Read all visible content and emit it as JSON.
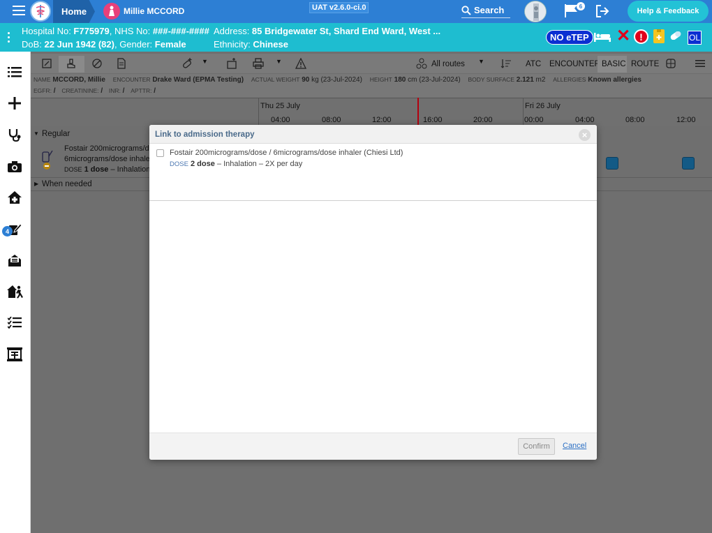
{
  "topbar": {
    "home_label": "Home",
    "patient_name": "Millie MCCORD",
    "env_version": "UAT v2.6.0-ci.0",
    "search_label": "Search",
    "flag_count": "6",
    "help_label": "Help & Feedback"
  },
  "banner": {
    "hospital_label": "Hospital No: ",
    "hospital_no": "F775979",
    "nhs_label": ", NHS No: ",
    "nhs_no": "###-###-####",
    "dob_label": "DoB: ",
    "dob": "22 Jun 1942 (82)",
    "gender_label": ", Gender: ",
    "gender": "Female",
    "address_label": "Address: ",
    "address": "85 Bridgewater St, Shard End Ward, West ...",
    "ethnicity_label": "Ethnicity: ",
    "ethnicity": "Chinese",
    "no_etep": "NO eTEP",
    "ol_badge": "OL",
    "alert_symbol": "!"
  },
  "sidebar": {
    "tasks_badge": "4"
  },
  "toolbar": {
    "routes_label": "All routes",
    "atc": "ATC",
    "encounter": "ENCOUNTER",
    "basic": "BASIC",
    "route": "ROUTE"
  },
  "patient_info": {
    "name_lbl": "NAME",
    "name": "MCCORD, Millie",
    "encounter_lbl": "ENCOUNTER",
    "encounter": "Drake Ward (EPMA Testing)",
    "weight_lbl": "ACTUAL WEIGHT",
    "weight": "90",
    "weight_unit": "kg",
    "weight_date": "(23-Jul-2024)",
    "height_lbl": "HEIGHT",
    "height": "180",
    "height_unit": "cm",
    "height_date": "(23-Jul-2024)",
    "bsa_lbl": "BODY SURFACE",
    "bsa": "2.121",
    "bsa_unit": "m2",
    "allergies_lbl": "ALLERGIES",
    "allergies": "Known allergies",
    "egfr_lbl": "EGFR:",
    "egfr": "/",
    "creat_lbl": "CREATININE:",
    "creat": "/",
    "inr_lbl": "INR:",
    "inr": "/",
    "apttr_lbl": "APTTR:",
    "apttr": "/"
  },
  "timeline": {
    "day1": "Thu 25 July",
    "day2": "Fri 26 July",
    "hours": [
      "04:00",
      "08:00",
      "12:00",
      "16:00",
      "20:00",
      "00:00",
      "04:00",
      "08:00",
      "12:00"
    ]
  },
  "rows": {
    "regular": "Regular",
    "drug_line1": "Fostair 200micrograms/d",
    "drug_line2": "6micrograms/dose inhale",
    "dose_lbl": "DOSE",
    "dose_val": "1 dose",
    "dose_rest": "– Inhalation",
    "when_needed": "When needed"
  },
  "modal": {
    "title": "Link to admission therapy",
    "close_symbol": "×",
    "therapy_name": "Fostair 200micrograms/dose / 6micrograms/dose inhaler (Chiesi Ltd)",
    "dose_lbl": "DOSE",
    "dose_val": "2 dose",
    "dose_rest": "– Inhalation – 2X per day",
    "confirm": "Confirm",
    "cancel": "Cancel"
  }
}
